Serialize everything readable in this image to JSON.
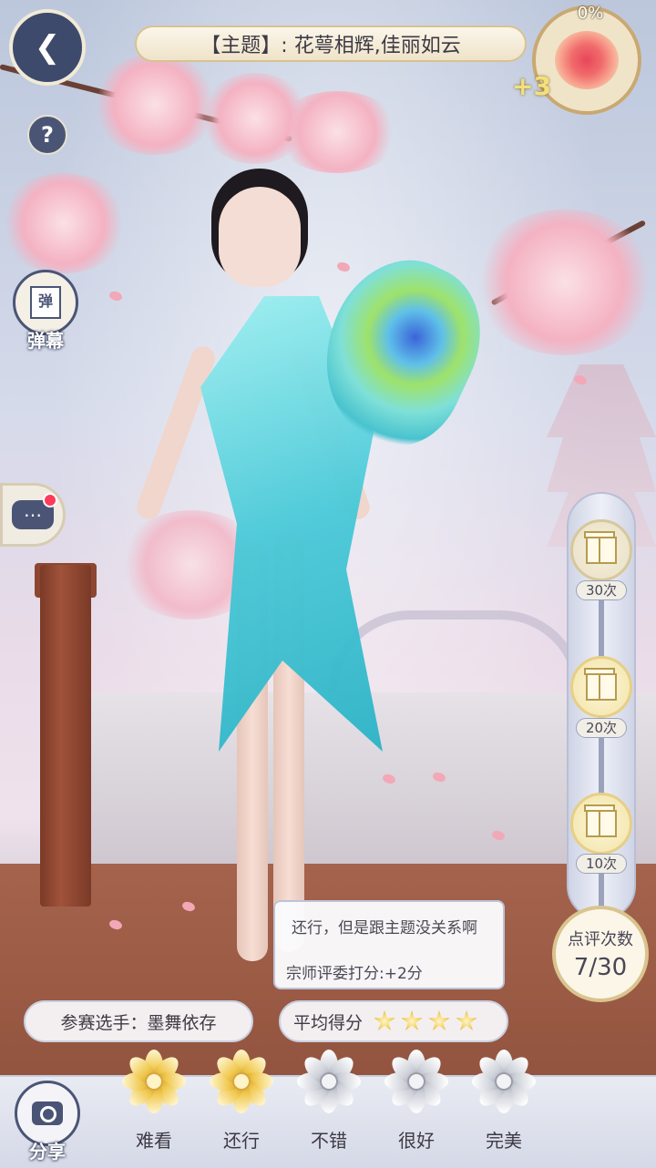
{
  "header": {
    "theme": "【主题】: 花萼相辉,佳丽如云",
    "progress_percent": "0%",
    "bonus": "+3"
  },
  "left_tools": {
    "danmu_icon_text": "弹",
    "danmu_label": "弹幕"
  },
  "rewards": [
    {
      "count": "30次",
      "state": "locked"
    },
    {
      "count": "20次",
      "state": "available"
    },
    {
      "count": "10次",
      "state": "available"
    }
  ],
  "review_count": {
    "label": "点评次数",
    "value": "7/30"
  },
  "comment": {
    "text": "还行，但是跟主题没关系啊",
    "score_text": "宗师评委打分:+2分"
  },
  "player": {
    "label": "参赛选手：墨舞依存"
  },
  "average": {
    "label": "平均得分",
    "stars": 4
  },
  "bottom": {
    "share_label": "分享",
    "ratings": [
      {
        "label": "难看",
        "style": "gold"
      },
      {
        "label": "还行",
        "style": "gold"
      },
      {
        "label": "不错",
        "style": "silver"
      },
      {
        "label": "很好",
        "style": "silver"
      },
      {
        "label": "完美",
        "style": "silver"
      }
    ]
  },
  "colors": {
    "accent_navy": "#4a5576",
    "gold": "#f0c84e",
    "notification": "#ff3b5c"
  }
}
